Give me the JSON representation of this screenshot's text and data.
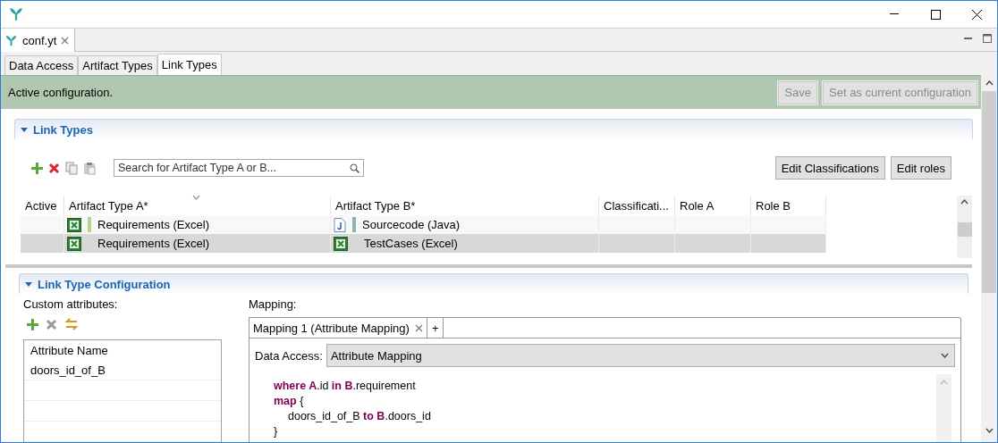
{
  "editor_tab": {
    "label": "conf.yt"
  },
  "page_tabs": [
    {
      "label": "Data Access",
      "selected": false
    },
    {
      "label": "Artifact Types",
      "selected": false
    },
    {
      "label": "Link Types",
      "selected": true
    }
  ],
  "status": {
    "message": "Active configuration.",
    "buttons": [
      {
        "label": "Save",
        "disabled": true
      },
      {
        "label": "Set as current configuration",
        "disabled": true
      }
    ]
  },
  "link_types": {
    "title": "Link Types",
    "expanded": true,
    "toolbar": [
      {
        "kind": "add",
        "disabled": false
      },
      {
        "kind": "delete",
        "disabled": false
      },
      {
        "kind": "copy",
        "disabled": true
      },
      {
        "kind": "paste",
        "disabled": true
      }
    ],
    "search": {
      "placeholder": "Search for Artifact Type A or B..."
    },
    "buttons": [
      "Edit Classifications",
      "Edit roles"
    ],
    "table": {
      "columns": [
        "Active",
        "Artifact Type A*",
        "Artifact Type B*",
        "Classificati...",
        "Role A",
        "Role B"
      ],
      "rows": [
        {
          "selected": false,
          "a": {
            "kind": "excel",
            "color": "#b5d68a",
            "text": "Requirements (Excel)"
          },
          "b": {
            "kind": "java",
            "color": "#8fb3ad",
            "text": "Sourcecode (Java)"
          }
        },
        {
          "selected": true,
          "a": {
            "kind": "excel",
            "text": "Requirements (Excel)"
          },
          "b": {
            "kind": "excel",
            "text": "TestCases (Excel)"
          }
        }
      ]
    }
  },
  "configuration": {
    "title": "Link Type Configuration",
    "expanded": true,
    "custom_attributes": {
      "label": "Custom attributes:",
      "toolbar": [
        {
          "kind": "add",
          "disabled": false
        },
        {
          "kind": "delete",
          "disabled": true
        },
        {
          "kind": "swap",
          "disabled": false
        }
      ],
      "column": "Attribute Name",
      "rows": [
        "doors_id_of_B"
      ]
    },
    "mapping": {
      "label": "Mapping:",
      "tabs": [
        {
          "label": "Mapping 1 (Attribute Mapping)",
          "selected": true
        }
      ],
      "add_tab": "+",
      "data_access_label": "Data Access:",
      "data_access_value": "Attribute Mapping",
      "code": [
        {
          "text": "**where A**.id **in B**.requirement",
          "indented": false
        },
        {
          "text": "**map** {",
          "indented": false
        },
        {
          "text": "doors_id_of_B **to B**.doors_id",
          "indented": true
        },
        {
          "text": "}",
          "indented": false
        }
      ]
    }
  }
}
